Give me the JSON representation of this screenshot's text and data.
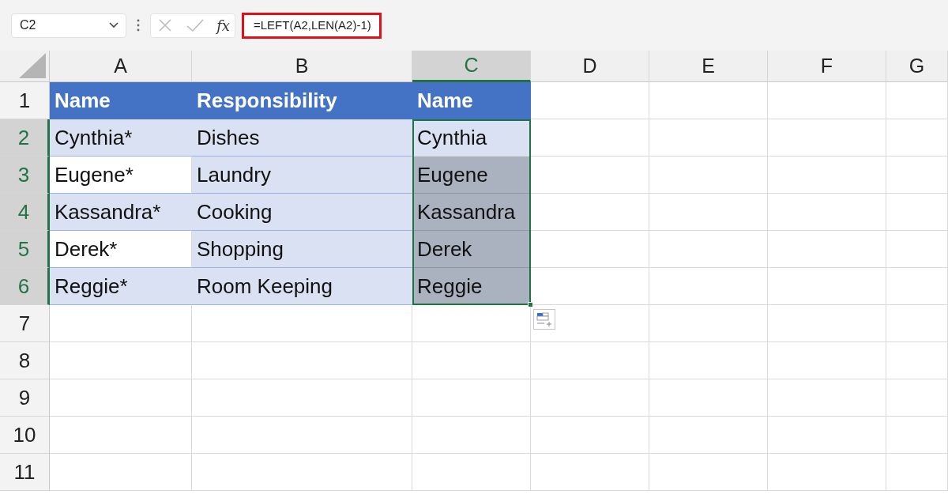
{
  "formula_bar": {
    "name_box": "C2",
    "function_label": "fx",
    "formula": "=LEFT(A2,LEN(A2)-1)"
  },
  "columns": [
    {
      "label": "A",
      "selected": false
    },
    {
      "label": "B",
      "selected": false
    },
    {
      "label": "C",
      "selected": true
    },
    {
      "label": "D",
      "selected": false
    },
    {
      "label": "E",
      "selected": false
    },
    {
      "label": "F",
      "selected": false
    },
    {
      "label": "G",
      "selected": false
    }
  ],
  "rows": [
    {
      "header": "1",
      "selected": false,
      "cells": [
        {
          "text": "Name",
          "kind": "header"
        },
        {
          "text": "Responsibility",
          "kind": "header"
        },
        {
          "text": "Name",
          "kind": "header"
        }
      ]
    },
    {
      "header": "2",
      "selected": true,
      "cells": [
        {
          "text": "Cynthia*",
          "kind": "band"
        },
        {
          "text": "Dishes",
          "kind": "band"
        },
        {
          "text": "Cynthia",
          "kind": "active"
        }
      ]
    },
    {
      "header": "3",
      "selected": true,
      "cells": [
        {
          "text": "Eugene*",
          "kind": "plain"
        },
        {
          "text": "Laundry",
          "kind": "band"
        },
        {
          "text": "Eugene",
          "kind": "selected"
        }
      ]
    },
    {
      "header": "4",
      "selected": true,
      "cells": [
        {
          "text": "Kassandra*",
          "kind": "band"
        },
        {
          "text": "Cooking",
          "kind": "band"
        },
        {
          "text": "Kassandra",
          "kind": "selected"
        }
      ]
    },
    {
      "header": "5",
      "selected": true,
      "cells": [
        {
          "text": "Derek*",
          "kind": "plain"
        },
        {
          "text": "Shopping",
          "kind": "band"
        },
        {
          "text": "Derek",
          "kind": "selected"
        }
      ]
    },
    {
      "header": "6",
      "selected": true,
      "cells": [
        {
          "text": "Reggie*",
          "kind": "band"
        },
        {
          "text": "Room Keeping",
          "kind": "band"
        },
        {
          "text": "Reggie",
          "kind": "selected"
        }
      ]
    },
    {
      "header": "7",
      "selected": false,
      "cells": []
    },
    {
      "header": "8",
      "selected": false,
      "cells": []
    },
    {
      "header": "9",
      "selected": false,
      "cells": []
    },
    {
      "header": "10",
      "selected": false,
      "cells": []
    },
    {
      "header": "11",
      "selected": false,
      "cells": []
    }
  ]
}
